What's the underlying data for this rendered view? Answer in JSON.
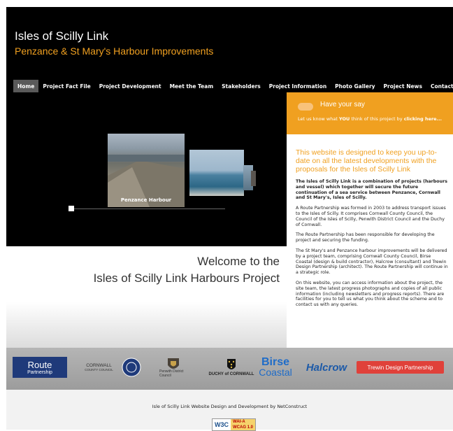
{
  "header": {
    "title": "Isles of Scilly Link",
    "subtitle": "Penzance & St Mary's Harbour Improvements"
  },
  "nav": {
    "items": [
      "Home",
      "Project Fact File",
      "Project Development",
      "Meet the Team",
      "Stakeholders",
      "Project Information",
      "Photo Gallery",
      "Project News",
      "Contact Us"
    ],
    "active": "Home"
  },
  "hero": {
    "caption": "Penzance Harbour"
  },
  "welcome": {
    "line1": "Welcome to the",
    "line2": "Isles of Scilly Link Harbours Project"
  },
  "sidebar": {
    "say_title": "Have your say",
    "say_text_prefix": "Let us know what ",
    "say_text_you": "YOU",
    "say_text_mid": " think of this project by ",
    "say_text_link": "clicking here...",
    "intro": "This website is designed to keep you up-to-date on all the latest developments with the proposals for the Isles of Scilly Link",
    "paragraphs": [
      "The Isles of Scilly Link is a combination of projects (harbours and vessel) which together will secure the future continuation of a sea service between Penzance, Cornwall and St Mary's, Isles of Scilly.",
      "A Route Partnership was formed in 2003 to address transport issues to the Isles of Scilly. It comprises Cornwall County Council, the Council of the Isles of Scilly, Penwith District Council and the Duchy of Cornwall.",
      "The Route Partnership has been responsible for developing the project and securing the funding.",
      "The St Mary's and Penzance harbour improvements will be delivered by a project team, comprising Cornwall County Council, Birse Coastal (design & build contractor), Halcrow (consultant) and Trewin Design Partnership (architect). The Route Partnership will continue in a strategic role.",
      "On this website, you can access information about the project, the site team, the latest progress photographs and copies of all public information (including newsletters and progress reports). There are facilities for you to tell us what you think about the scheme and to contact us with any queries."
    ]
  },
  "logos": {
    "route": "Route",
    "route_sub": "Partnership",
    "cornwall": "CORNWALL",
    "cornwall_sub": "COUNTY COUNCIL",
    "penwith": "Penwith District Council",
    "duchy": "DUCHY of CORNWALL",
    "birse1": "Birse",
    "birse2": "Coastal",
    "halcrow": "Halcrow",
    "trewin": "Trewin Design Partnership"
  },
  "footer": {
    "text": "Isle of Scilly Link Website Design and Development by NetConstruct",
    "badge_w3c": "W3C",
    "badge_wai1": "WAI-A",
    "badge_wai2": "WCAG 1.0"
  },
  "colors": {
    "accent": "#f0a020",
    "background": "#000000"
  }
}
